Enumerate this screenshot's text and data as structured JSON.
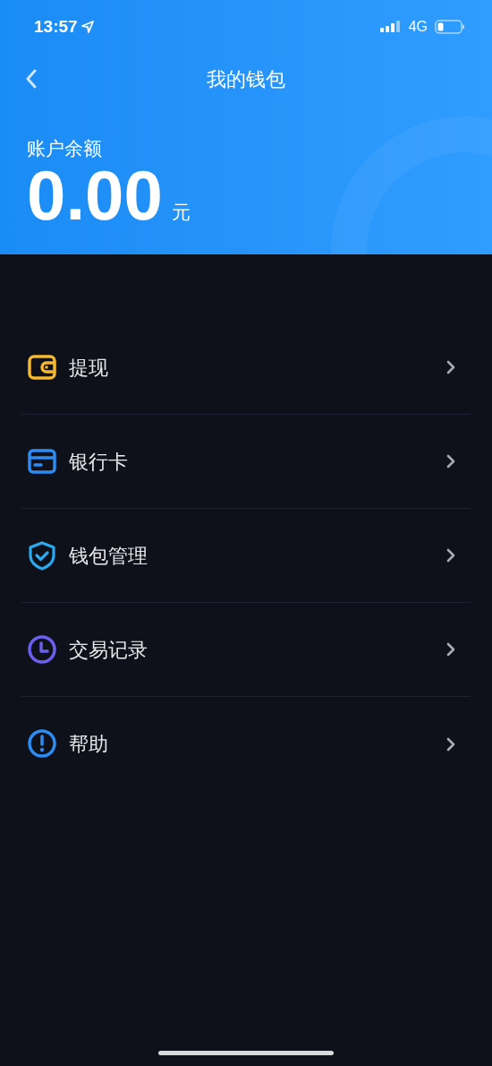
{
  "status_bar": {
    "time": "13:57",
    "network": "4G"
  },
  "nav": {
    "title": "我的钱包"
  },
  "balance": {
    "label": "账户余额",
    "amount": "0.00",
    "unit": "元"
  },
  "menu": [
    {
      "kind": "wallet",
      "label": "提现"
    },
    {
      "kind": "card",
      "label": "银行卡"
    },
    {
      "kind": "shield",
      "label": "钱包管理"
    },
    {
      "kind": "clock",
      "label": "交易记录"
    },
    {
      "kind": "help",
      "label": "帮助"
    }
  ]
}
